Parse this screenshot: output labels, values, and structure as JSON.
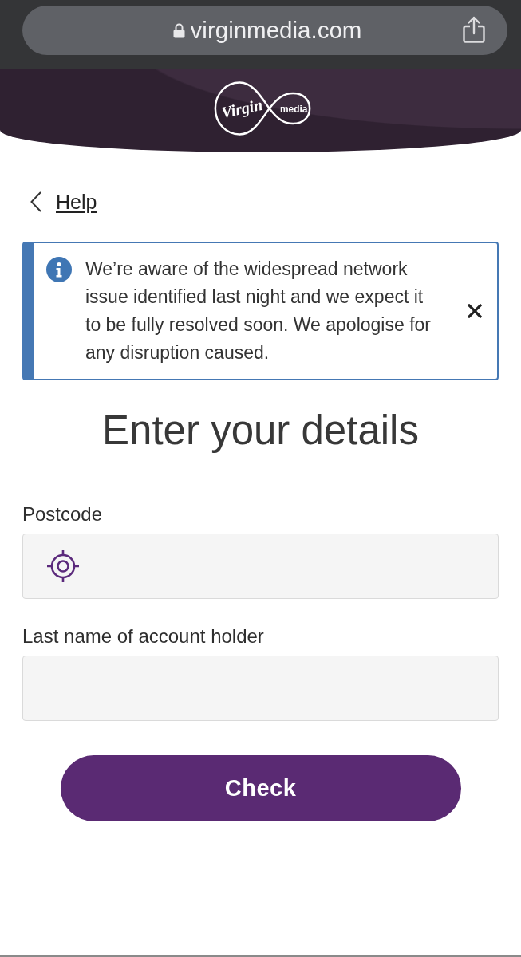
{
  "browser": {
    "url": "virginmedia.com"
  },
  "header": {
    "logo": {
      "brand": "Virgin",
      "suffix": "media"
    }
  },
  "back_link": {
    "label": "Help"
  },
  "alert": {
    "kind": "info",
    "message": "We’re aware of the widespread network issue identified last night and we expect it to be fully resolved soon. We apologise for any disruption caused."
  },
  "heading": "Enter your details",
  "fields": [
    {
      "label": "Postcode",
      "kind": "location"
    },
    {
      "label": "Last name of account holder",
      "kind": "text"
    }
  ],
  "button": {
    "label": "Check"
  }
}
